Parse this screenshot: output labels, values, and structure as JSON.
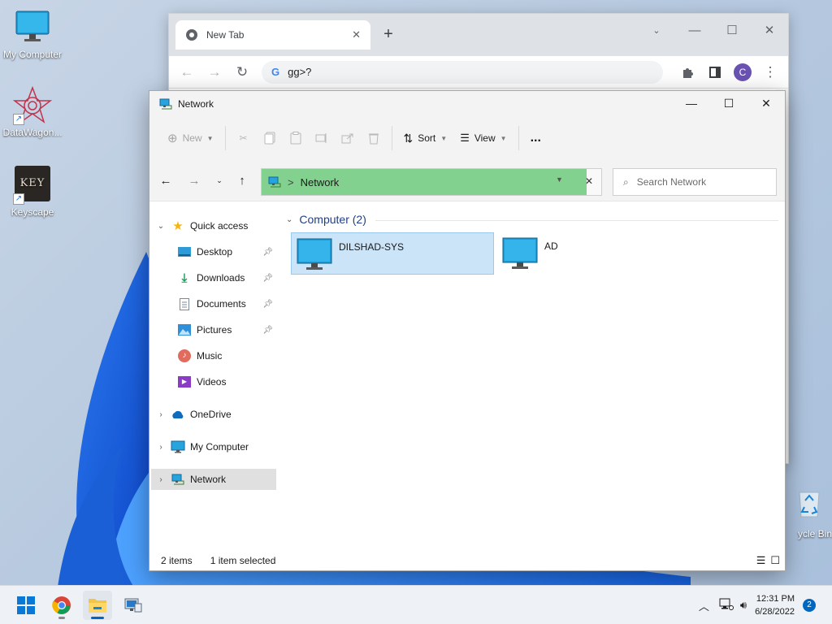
{
  "desktop": {
    "icons": [
      {
        "label": "My Computer",
        "icon": "monitor-icon"
      },
      {
        "label": "DataWagon...",
        "icon": "datawagon-icon"
      },
      {
        "label": "Keyscape",
        "icon": "keyscape-icon",
        "badge_text": "KEY"
      },
      {
        "label": "ycle Bin",
        "icon": "recycle-bin-icon"
      }
    ]
  },
  "chrome": {
    "tab_title": "New Tab",
    "address_text": "gg>?",
    "search_engine_glyph": "G",
    "profile_initial": "C"
  },
  "explorer": {
    "window_title": "Network",
    "commands": {
      "new": "New",
      "sort": "Sort",
      "view": "View",
      "more": "..."
    },
    "address": {
      "location": "Network",
      "separator": ">"
    },
    "search_placeholder": "Search Network",
    "nav": {
      "quick_access": "Quick access",
      "desktop": "Desktop",
      "downloads": "Downloads",
      "documents": "Documents",
      "pictures": "Pictures",
      "music": "Music",
      "videos": "Videos",
      "onedrive": "OneDrive",
      "my_computer": "My Computer",
      "network": "Network"
    },
    "group": {
      "title": "Computer (2)",
      "items": [
        {
          "name": "DILSHAD-SYS",
          "selected": true
        },
        {
          "name": "AD",
          "selected": false
        }
      ]
    },
    "status": {
      "count": "2 items",
      "selection": "1 item selected"
    }
  },
  "taskbar": {
    "apps": [
      "start-icon",
      "chrome-icon",
      "file-explorer-icon",
      "network-app-icon"
    ],
    "time": "12:31 PM",
    "date": "6/28/2022",
    "notification_count": "2"
  },
  "colors": {
    "accent": "#0067c0",
    "address_highlight": "#82d18e",
    "selection": "#cce4f7"
  }
}
